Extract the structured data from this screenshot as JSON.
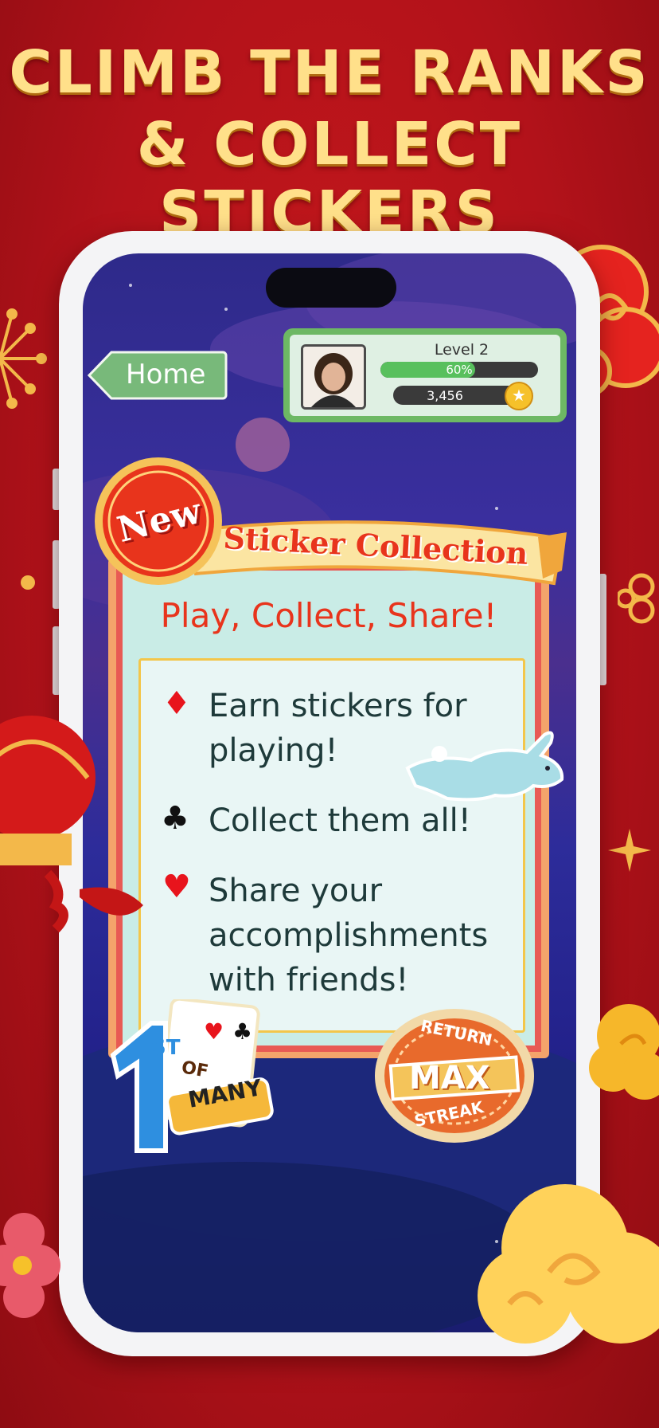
{
  "headline": {
    "line1": "CLIMB THE RANKS",
    "line2": "& COLLECT STICKERS"
  },
  "nav": {
    "home_label": "Home"
  },
  "profile": {
    "level_label": "Level 2",
    "xp_percent_label": "60%",
    "xp_progress": 0.6,
    "coins": "3,456"
  },
  "promo": {
    "badge": "New",
    "banner": "Sticker Collection",
    "tagline": "Play, Collect, Share!",
    "items": [
      {
        "suit": "diamond",
        "line1": "Earn stickers for",
        "line2": "playing!"
      },
      {
        "suit": "club",
        "line1": "Collect them all!"
      },
      {
        "suit": "heart",
        "line1": "Share your",
        "line2": "accomplishments",
        "line3": "with friends!"
      }
    ]
  },
  "stickers": {
    "first": {
      "number": "1",
      "sup": "ST",
      "of": "OF",
      "many": "MANY"
    },
    "streak": {
      "top": "RETURN",
      "mid": "MAX",
      "bottom": "STREAK"
    }
  },
  "colors": {
    "background": "#b3121a",
    "headline": "#ffe08a",
    "accent_red": "#e8341c",
    "green": "#58c05d"
  }
}
